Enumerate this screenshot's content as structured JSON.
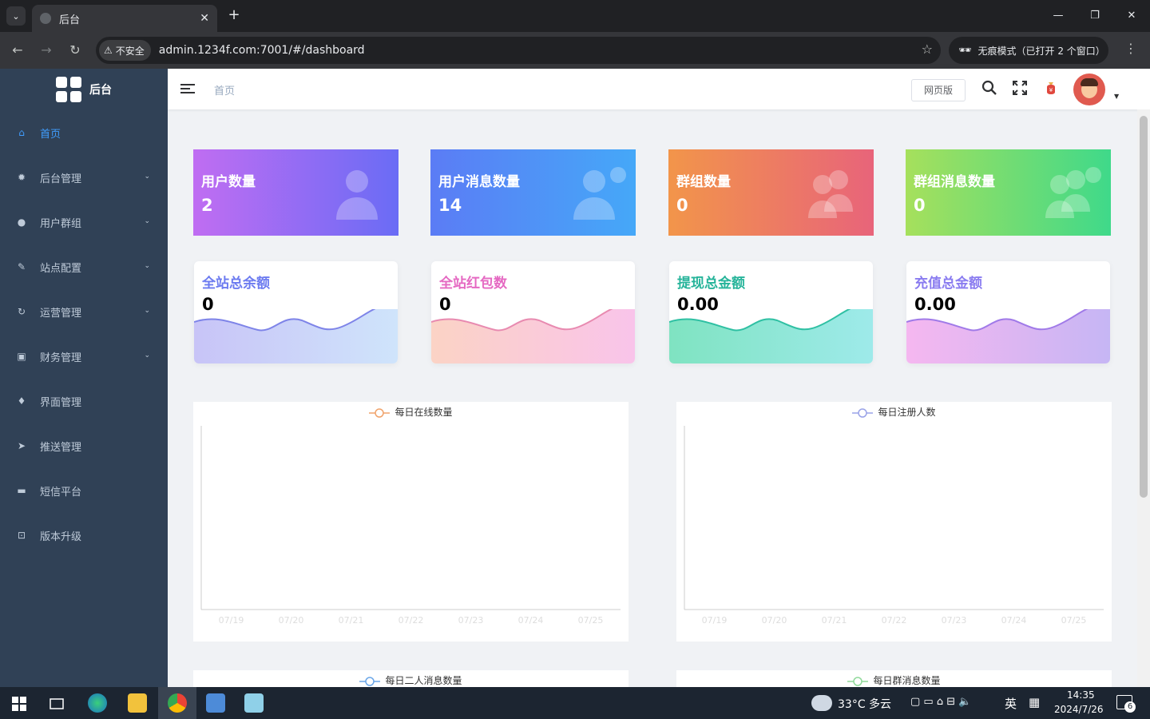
{
  "browser": {
    "tab_title": "后台",
    "url": "admin.1234f.com:7001/#/dashboard",
    "insecure_label": "不安全",
    "incognito_label": "无痕模式（已打开 2 个窗口）"
  },
  "sidebar": {
    "brand": "后台",
    "items": [
      {
        "label": "首页",
        "icon": "home-icon",
        "active": true,
        "has_arrow": false
      },
      {
        "label": "后台管理",
        "icon": "gear-icon",
        "active": false,
        "has_arrow": true
      },
      {
        "label": "用户群组",
        "icon": "user-icon",
        "active": false,
        "has_arrow": true
      },
      {
        "label": "站点配置",
        "icon": "wrench-icon",
        "active": false,
        "has_arrow": true
      },
      {
        "label": "运营管理",
        "icon": "refresh-icon",
        "active": false,
        "has_arrow": true
      },
      {
        "label": "财务管理",
        "icon": "wallet-icon",
        "active": false,
        "has_arrow": true
      },
      {
        "label": "界面管理",
        "icon": "shirt-icon",
        "active": false,
        "has_arrow": false
      },
      {
        "label": "推送管理",
        "icon": "send-icon",
        "active": false,
        "has_arrow": false
      },
      {
        "label": "短信平台",
        "icon": "message-icon",
        "active": false,
        "has_arrow": false
      },
      {
        "label": "版本升级",
        "icon": "upgrade-icon",
        "active": false,
        "has_arrow": false
      }
    ]
  },
  "header": {
    "breadcrumb": "首页",
    "web_version_button": "网页版"
  },
  "stats": [
    {
      "title": "用户数量",
      "value": "2",
      "gradient": [
        "#c06df2",
        "#6a6cf5"
      ],
      "icon": "user-silhouette-icon"
    },
    {
      "title": "用户消息数量",
      "value": "14",
      "gradient": [
        "#5b7cf5",
        "#45a8f8"
      ],
      "icon": "user-message-icon"
    },
    {
      "title": "群组数量",
      "value": "0",
      "gradient": [
        "#f2954a",
        "#e8647a"
      ],
      "icon": "group-icon"
    },
    {
      "title": "群组消息数量",
      "value": "0",
      "gradient": [
        "#a6e05c",
        "#3fd98a"
      ],
      "icon": "group-message-icon"
    }
  ],
  "wave_cards": [
    {
      "title": "全站总余额",
      "value": "0",
      "title_color": "#6c7bf0",
      "line_color": "#7e84e8",
      "fill": [
        "#c8c4f7",
        "#cfe4fb"
      ]
    },
    {
      "title": "全站红包数",
      "value": "0",
      "title_color": "#e569c2",
      "line_color": "#e88ab0",
      "fill": [
        "#fbd3c5",
        "#f9c4ea"
      ]
    },
    {
      "title": "提现总金额",
      "value": "0.00",
      "title_color": "#26b49a",
      "line_color": "#2fc0a3",
      "fill": [
        "#7fe3c1",
        "#9eeaea"
      ]
    },
    {
      "title": "充值总金额",
      "value": "0.00",
      "title_color": "#8a7cf0",
      "line_color": "#a07ae8",
      "fill": [
        "#f5b7f0",
        "#c6b6f4"
      ]
    }
  ],
  "chart_data": [
    {
      "type": "line",
      "series": [
        {
          "name": "每日在线数量",
          "values": [
            0,
            0,
            0,
            0,
            0,
            0,
            0
          ]
        }
      ],
      "categories": [
        "07/19",
        "07/20",
        "07/21",
        "07/22",
        "07/23",
        "07/24",
        "07/25"
      ],
      "legend_color": "#f0a36b"
    },
    {
      "type": "line",
      "series": [
        {
          "name": "每日注册人数",
          "values": [
            0,
            0,
            0,
            0,
            0,
            0,
            0
          ]
        }
      ],
      "categories": [
        "07/19",
        "07/20",
        "07/21",
        "07/22",
        "07/23",
        "07/24",
        "07/25"
      ],
      "legend_color": "#9aa3e8"
    },
    {
      "type": "line",
      "series": [
        {
          "name": "每日二人消息数量",
          "values": []
        }
      ],
      "categories": [],
      "legend_color": "#6aa6e8"
    },
    {
      "type": "line",
      "series": [
        {
          "name": "每日群消息数量",
          "values": []
        }
      ],
      "categories": [],
      "legend_color": "#8fd99a"
    }
  ],
  "taskbar": {
    "weather": "33°C 多云",
    "ime": "英",
    "time": "14:35",
    "date": "2024/7/26",
    "notifications": "6"
  }
}
